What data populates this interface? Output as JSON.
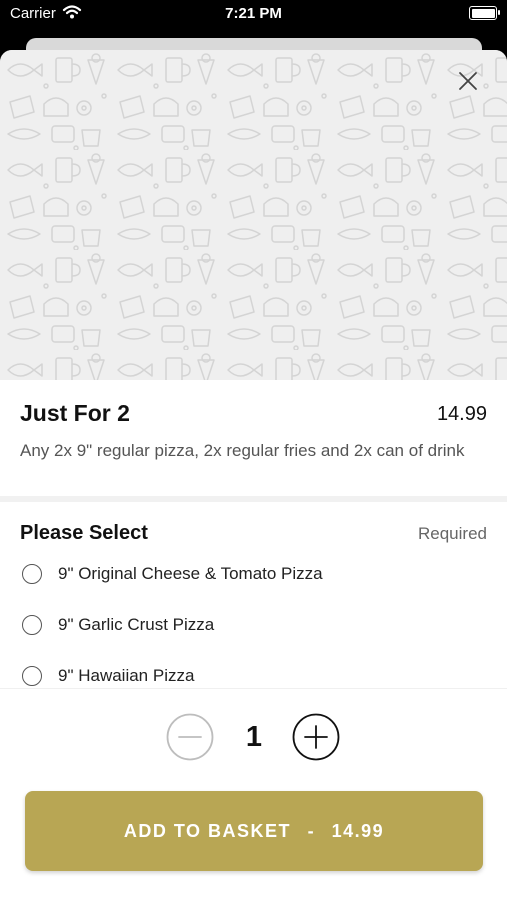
{
  "status_bar": {
    "carrier": "Carrier",
    "time": "7:21 PM"
  },
  "item": {
    "title": "Just For 2",
    "price": "14.99",
    "description": "Any 2x 9\" regular pizza, 2x regular fries and 2x can of drink"
  },
  "selection": {
    "title": "Please Select",
    "required_label": "Required",
    "options": [
      {
        "label": "9\" Original Cheese & Tomato Pizza"
      },
      {
        "label": "9\" Garlic Crust Pizza"
      },
      {
        "label": "9\" Hawaiian Pizza"
      }
    ]
  },
  "quantity": {
    "value": "1"
  },
  "add_button": {
    "label": "ADD TO BASKET",
    "separator": "-",
    "price": "14.99"
  },
  "colors": {
    "accent": "#b8a654",
    "hero_background": "#efefef"
  },
  "icons": {
    "close": "close-icon",
    "minus": "minus-circle-icon",
    "plus": "plus-circle-icon",
    "wifi": "wifi-icon",
    "battery": "battery-icon"
  }
}
